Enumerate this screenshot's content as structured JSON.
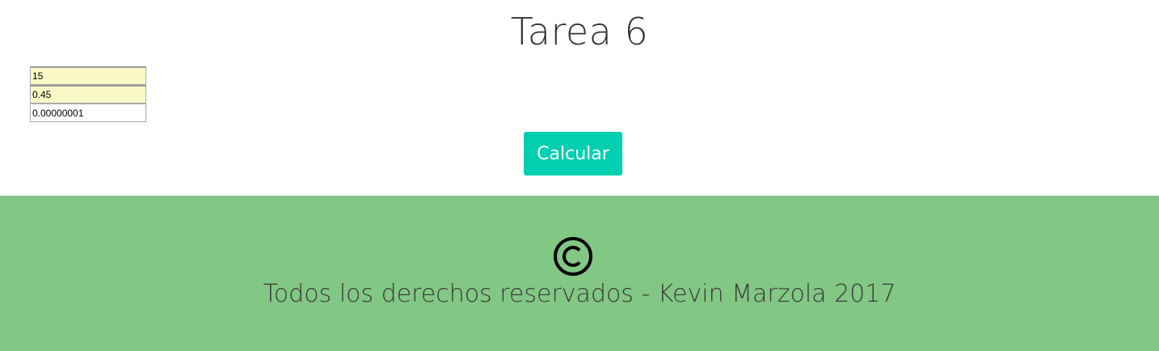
{
  "header": {
    "title": "Tarea 6"
  },
  "form": {
    "field1_value": "15",
    "field2_value": "0.45",
    "field3_value": "0.00000001",
    "calculate_label": "Calcular"
  },
  "footer": {
    "icon": "copyright-icon",
    "text": "Todos los derechos reservados - Kevin Marzola 2017"
  },
  "colors": {
    "accent": "#00cfb0",
    "footer_background": "#82c784",
    "autofill_background": "#fafac8"
  }
}
